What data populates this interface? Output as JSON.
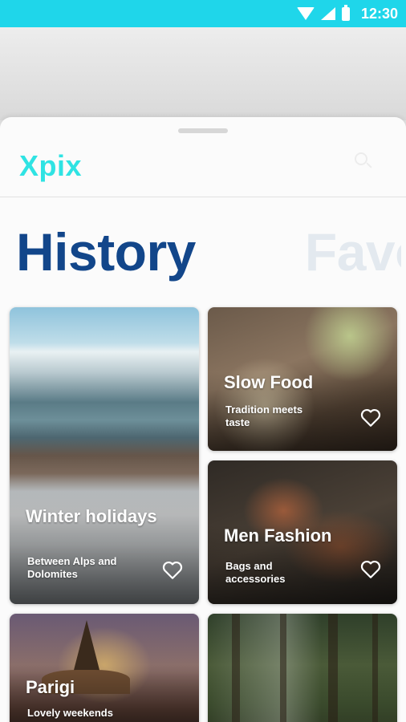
{
  "status_bar": {
    "time": "12:30"
  },
  "app": {
    "name": "Xpix"
  },
  "tabs": [
    {
      "label": "History",
      "active": true
    },
    {
      "label": "Favo",
      "active": false
    }
  ],
  "cards": [
    {
      "title": "Winter holidays",
      "subtitle": "Between Alps and Dolomites"
    },
    {
      "title": "Slow Food",
      "subtitle": "Tradition meets taste"
    },
    {
      "title": "Men Fashion",
      "subtitle": "Bags and accessories"
    },
    {
      "title": "Parigi",
      "subtitle": "Lovely weekends"
    },
    {
      "title": "",
      "subtitle": ""
    }
  ],
  "colors": {
    "status_bar": "#1fd6ea",
    "logo": "#2fe3e3",
    "active_tab": "#12468a",
    "inactive_tab": "#e3e9ef"
  },
  "icons": [
    "wifi-icon",
    "signal-icon",
    "battery-icon",
    "search-icon",
    "heart-icon"
  ]
}
